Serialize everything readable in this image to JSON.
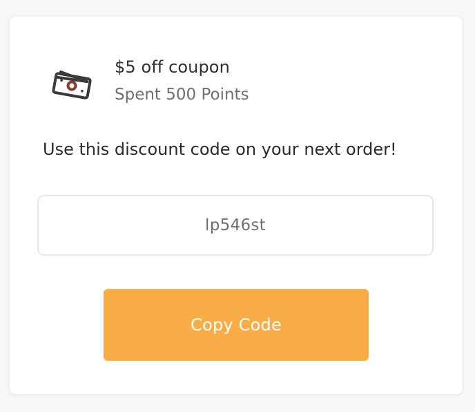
{
  "coupon": {
    "title": "$5 off coupon",
    "subtitle": "Spent 500 Points",
    "icon": "money-icon"
  },
  "instruction": "Use this discount code on your next order!",
  "code": {
    "value": "lp546st"
  },
  "copy_button": {
    "label": "Copy Code"
  },
  "colors": {
    "button_bg": "#f9ad46",
    "button_text": "#ffffff",
    "icon_stroke": "#3a3a3a",
    "icon_accent": "#8a3b32"
  }
}
